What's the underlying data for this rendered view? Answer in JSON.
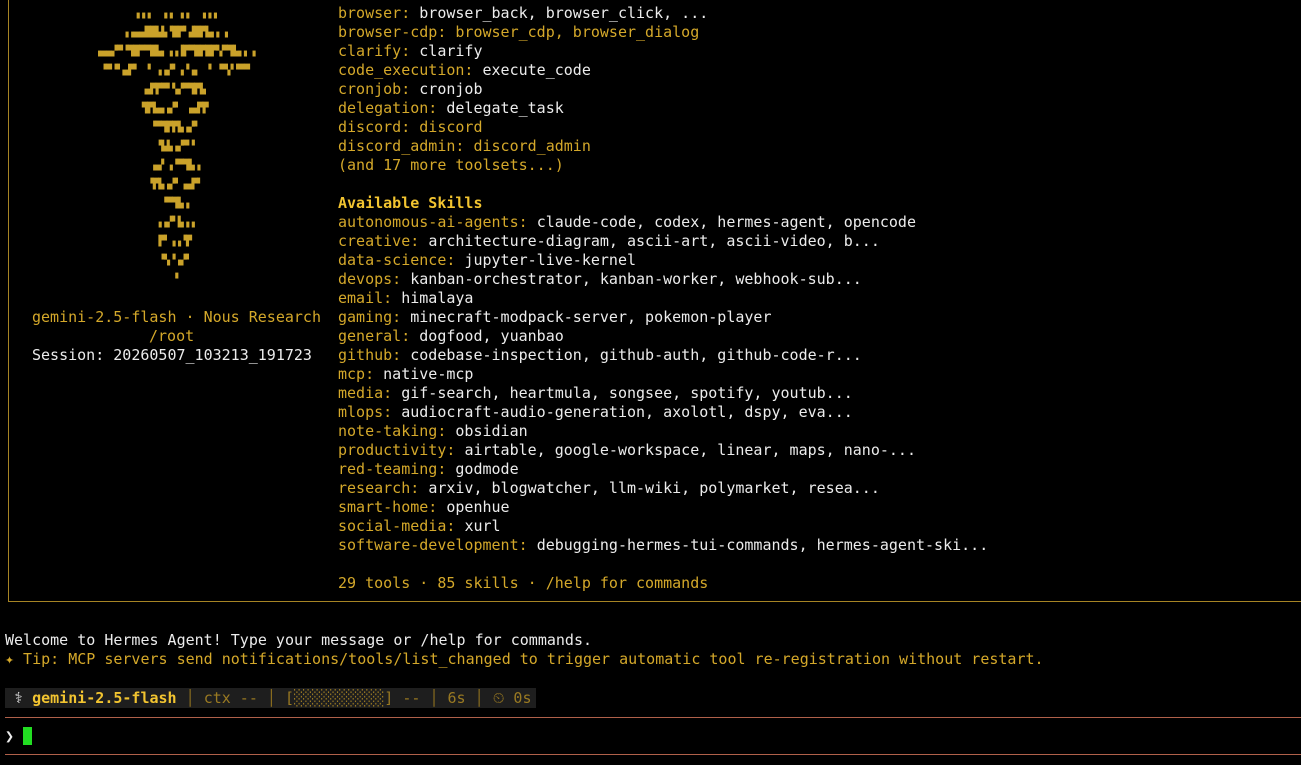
{
  "art_rows": [
    "▗▗▗  ▗▗ ▗▗  ▗▗▗",
    "▗▗▄▄██▙▙▝█▛▘▟█▛▙▖▖▗",
    "▗▄▄▞▀▝▜█▀▀█▙▖▗▗▐▛▀█▛█▛▚▀▜▙▖▖▗",
    "▝▀▝▘▄▛▘ ▝ ▗▗▞▘▗▝▗▖ ▝ ▝▀▞▝▀▀",
    "▄▛▛▀▘▚▞▀▜▛▙",
    "▜▛▙▄▗▞▘ ▗▄▛▛",
    "▝▀▜▛▛▙▗▞▘",
    "▝▙▙▗▞▀▝",
    "▗▄▘▗▝▀▜▙▗",
    "▝▛▙▗▞▘▗▄▛▘",
    "▝▀▜▙▗",
    "▗▗▞▘▙▗▗",
    "▛▘▗▗▝▛",
    "▝▚▝▗▞▘",
    "▝"
  ],
  "banner": {
    "model": "gemini-2.5-flash",
    "provider_sep": " · ",
    "provider": "Nous Research",
    "cwd": "/root",
    "session_label": "Session: ",
    "session_id": "20260507_103213_191723"
  },
  "toolsets": [
    {
      "key": "browser:",
      "value": "browser_back, browser_click, ...",
      "value_gold": false
    },
    {
      "key": "browser-cdp:",
      "value": "browser_cdp, browser_dialog",
      "value_gold": true
    },
    {
      "key": "clarify:",
      "value": "clarify",
      "value_gold": false
    },
    {
      "key": "code_execution:",
      "value": "execute_code",
      "value_gold": false
    },
    {
      "key": "cronjob:",
      "value": "cronjob",
      "value_gold": false
    },
    {
      "key": "delegation:",
      "value": "delegate_task",
      "value_gold": false
    },
    {
      "key": "discord:",
      "value": "discord",
      "value_gold": true
    },
    {
      "key": "discord_admin:",
      "value": "discord_admin",
      "value_gold": true
    }
  ],
  "toolsets_more": "(and 17 more toolsets...)",
  "skills_heading": "Available Skills",
  "skills": [
    {
      "key": "autonomous-ai-agents:",
      "value": "claude-code, codex, hermes-agent, opencode"
    },
    {
      "key": "creative:",
      "value": "architecture-diagram, ascii-art, ascii-video, b..."
    },
    {
      "key": "data-science:",
      "value": "jupyter-live-kernel"
    },
    {
      "key": "devops:",
      "value": "kanban-orchestrator, kanban-worker, webhook-sub..."
    },
    {
      "key": "email:",
      "value": "himalaya"
    },
    {
      "key": "gaming:",
      "value": "minecraft-modpack-server, pokemon-player"
    },
    {
      "key": "general:",
      "value": "dogfood, yuanbao"
    },
    {
      "key": "github:",
      "value": "codebase-inspection, github-auth, github-code-r..."
    },
    {
      "key": "mcp:",
      "value": "native-mcp"
    },
    {
      "key": "media:",
      "value": "gif-search, heartmula, songsee, spotify, youtub..."
    },
    {
      "key": "mlops:",
      "value": "audiocraft-audio-generation, axolotl, dspy, eva..."
    },
    {
      "key": "note-taking:",
      "value": "obsidian"
    },
    {
      "key": "productivity:",
      "value": "airtable, google-workspace, linear, maps, nano-..."
    },
    {
      "key": "red-teaming:",
      "value": "godmode"
    },
    {
      "key": "research:",
      "value": "arxiv, blogwatcher, llm-wiki, polymarket, resea..."
    },
    {
      "key": "smart-home:",
      "value": "openhue"
    },
    {
      "key": "social-media:",
      "value": "xurl"
    },
    {
      "key": "software-development:",
      "value": "debugging-hermes-tui-commands, hermes-agent-ski..."
    }
  ],
  "summary": "29 tools · 85 skills · /help for commands",
  "welcome": "Welcome to Hermes Agent! Type your message or /help for commands.",
  "tip": "✦ Tip: MCP servers send notifications/tools/list_changed to trigger automatic tool re-registration without restart.",
  "statusbar": {
    "icon": "⚕",
    "model": "gemini-2.5-flash",
    "ctx": "ctx --",
    "bar": "[░░░░░░░░░░] --",
    "elapsed": "6s",
    "timer_icon": "⏲",
    "timer": "0s"
  },
  "prompt_symbol": "❯",
  "input_value": ""
}
